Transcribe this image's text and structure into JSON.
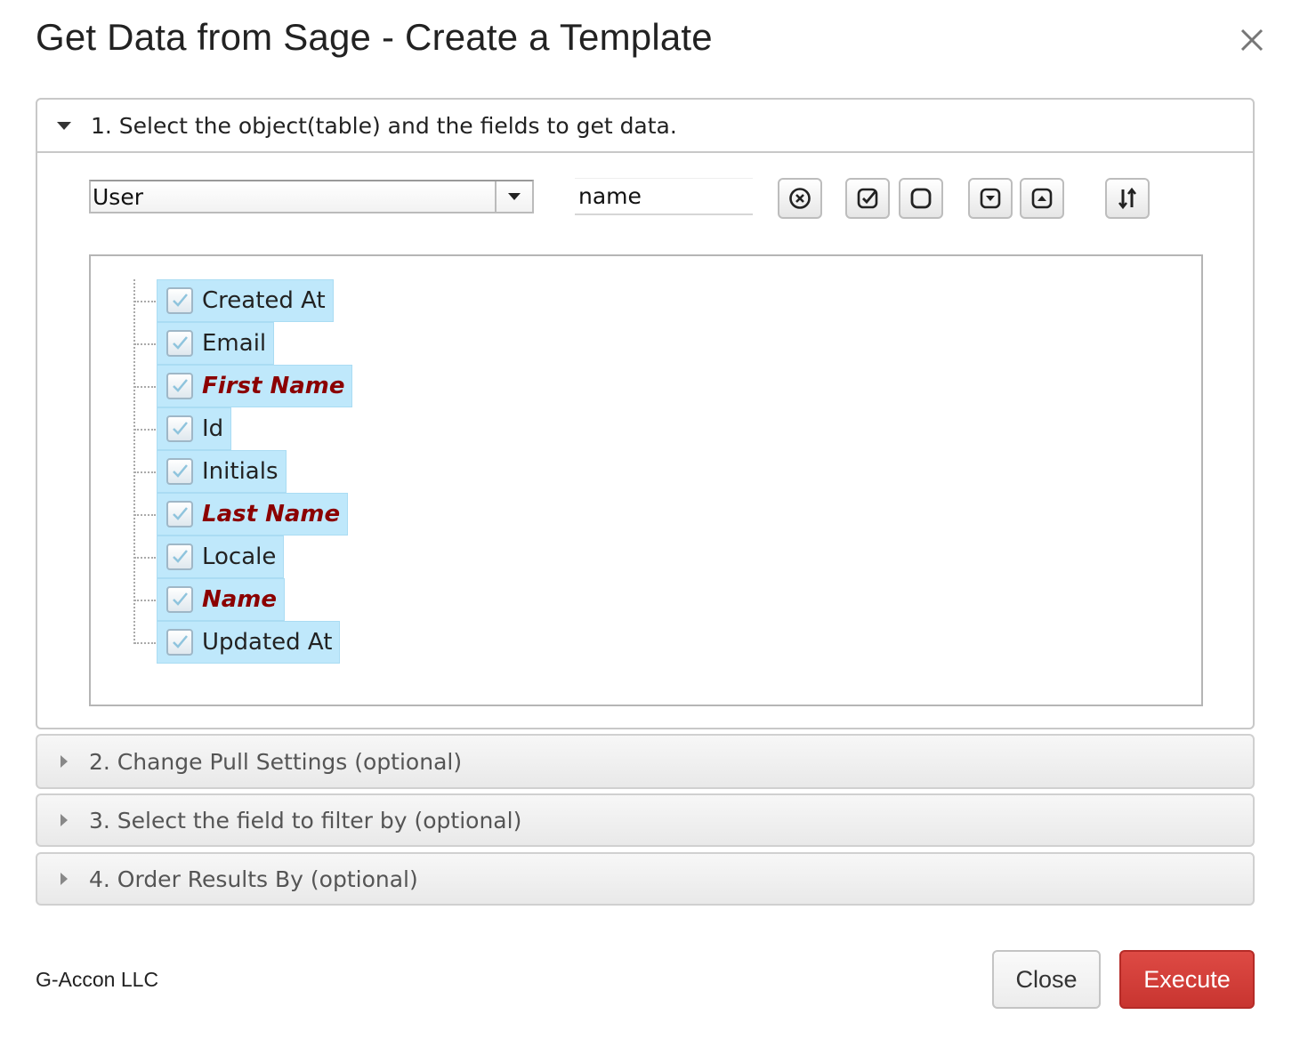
{
  "dialog": {
    "title": "Get Data from Sage - Create a Template",
    "close_icon": "close-icon"
  },
  "section1": {
    "header": "1. Select the object(table) and the fields to get data.",
    "object_select_value": "User",
    "filter_input_value": "name",
    "toolbar_icons": [
      "clear-filter-icon",
      "check-all-icon",
      "uncheck-all-icon",
      "expand-icon",
      "collapse-icon",
      "sort-icon"
    ],
    "fields": [
      {
        "label": "Created At",
        "checked": true,
        "required": false
      },
      {
        "label": "Email",
        "checked": true,
        "required": false
      },
      {
        "label": "First Name",
        "checked": true,
        "required": true
      },
      {
        "label": "Id",
        "checked": true,
        "required": false
      },
      {
        "label": "Initials",
        "checked": true,
        "required": false
      },
      {
        "label": "Last Name",
        "checked": true,
        "required": true
      },
      {
        "label": "Locale",
        "checked": true,
        "required": false
      },
      {
        "label": "Name",
        "checked": true,
        "required": true
      },
      {
        "label": "Updated At",
        "checked": true,
        "required": false
      }
    ]
  },
  "section2": {
    "header": "2. Change Pull Settings (optional)"
  },
  "section3": {
    "header": "3. Select the field to filter by (optional)"
  },
  "section4": {
    "header": "4. Order Results By (optional)"
  },
  "footer": {
    "brand": "G-Accon LLC",
    "close_label": "Close",
    "execute_label": "Execute"
  },
  "colors": {
    "required_field": "#8b0000",
    "selected_item_bg": "#bfe8fb",
    "execute_button": "#d0403a"
  }
}
